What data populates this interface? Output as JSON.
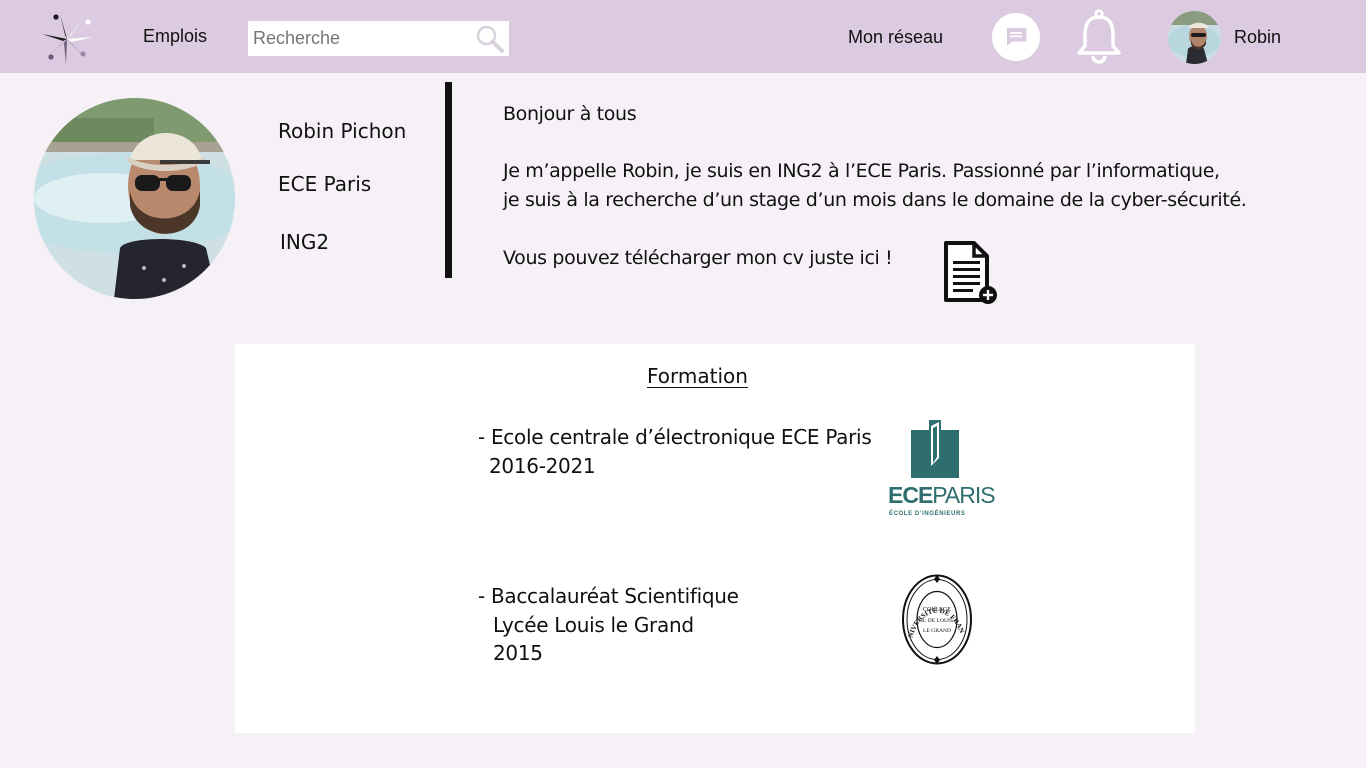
{
  "header": {
    "jobs_label": "Emplois",
    "search_placeholder": "Recherche",
    "network_label": "Mon réseau",
    "user_name": "Robin",
    "icons": {
      "search": "search-icon",
      "messages": "chat-icon",
      "notifications": "bell-icon"
    },
    "bar_color": "#dccbe0"
  },
  "profile": {
    "name": "Robin Pichon",
    "school": "ECE Paris",
    "level": "ING2"
  },
  "bio": {
    "greeting": "Bonjour à tous",
    "line1": "Je m’appelle Robin, je suis en ING2 à l’ECE Paris. Passionné par l’informatique,",
    "line2": "je suis à la recherche d’un stage d’un mois dans le domaine de la cyber-sécurité.",
    "cv_text": "Vous pouvez télécharger mon cv juste ici !"
  },
  "formation": {
    "title": "Formation",
    "items": [
      {
        "title": "- Ecole centrale d’électronique ECE Paris",
        "years": "2016-2021"
      },
      {
        "title": "- Baccalauréat Scientifique",
        "school": "Lycée Louis le Grand",
        "year": "2015"
      }
    ],
    "ece_logo": {
      "word_bold": "ECE",
      "word": "PARIS",
      "sub": "ÉCOLE D’INGÉNIEURS",
      "color": "#2f6e6e"
    },
    "seal": {
      "outer_left": "UNIVERSITÉ",
      "outer_right": "DE FRANCE",
      "inner1": "COLLEGE",
      "inner2": "R: DE LOUIS",
      "inner3": "LE GRAND"
    }
  }
}
